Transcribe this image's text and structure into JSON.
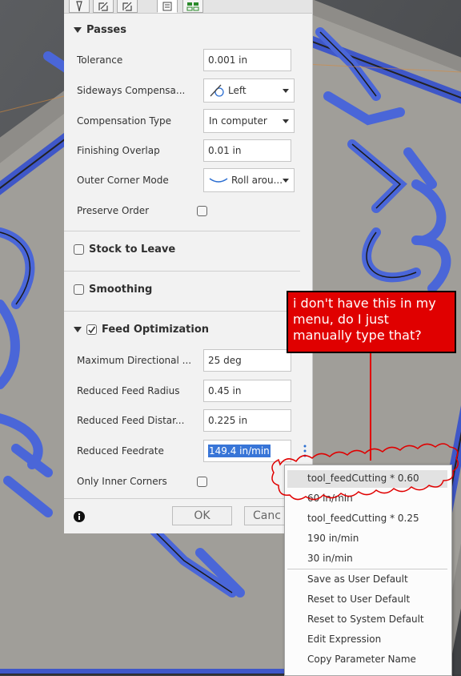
{
  "panel": {
    "tabs": [
      "tool-icon",
      "geometry-icon",
      "heights-icon",
      "passes-icon",
      "linking-icon"
    ],
    "passes": {
      "title": "Passes",
      "tolerance": {
        "label": "Tolerance",
        "value": "0.001 in"
      },
      "sideways": {
        "label": "Sideways Compensa...",
        "value": "Left"
      },
      "comp_type": {
        "label": "Compensation Type",
        "value": "In computer"
      },
      "finishing_overlap": {
        "label": "Finishing Overlap",
        "value": "0.01 in"
      },
      "outer_corner": {
        "label": "Outer Corner Mode",
        "value": "Roll arou..."
      },
      "preserve_order": {
        "label": "Preserve Order",
        "checked": false
      }
    },
    "stock_to_leave": {
      "label": "Stock to Leave",
      "checked": false
    },
    "smoothing": {
      "label": "Smoothing",
      "checked": false
    },
    "feed_opt": {
      "label": "Feed Optimization",
      "checked": true,
      "max_dir": {
        "label": "Maximum Directional ...",
        "value": "25 deg"
      },
      "red_feed_radius": {
        "label": "Reduced Feed Radius",
        "value": "0.45 in"
      },
      "red_feed_dist": {
        "label": "Reduced Feed Distar...",
        "value": "0.225 in"
      },
      "red_feedrate": {
        "label": "Reduced Feedrate",
        "value": "149.4 in/min"
      },
      "only_inner": {
        "label": "Only Inner Corners",
        "checked": false
      }
    },
    "ok_label": "OK",
    "cancel_label": "Canc"
  },
  "annotation": {
    "text": "i don't have this in my menu, do I just manually type that?",
    "color": "#e00000"
  },
  "menu": {
    "items": [
      "tool_feedCutting * 0.60",
      "60 in/min",
      "tool_feedCutting * 0.25",
      "190 in/min",
      "30 in/min"
    ],
    "actions": [
      "Save as User Default",
      "Reset to User Default",
      "Reset to System Default",
      "Edit Expression",
      "Copy Parameter Name"
    ]
  },
  "colors": {
    "accent": "#3875d7",
    "model_outline": "#4a66d8",
    "panel_bg": "#f2f2f2"
  }
}
